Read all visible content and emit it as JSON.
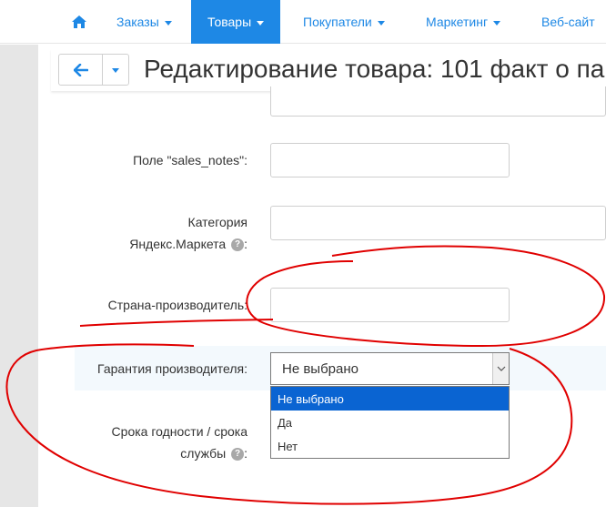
{
  "nav": {
    "items": [
      {
        "label": "Заказы",
        "active": false
      },
      {
        "label": "Товары",
        "active": true
      },
      {
        "label": "Покупатели",
        "active": false
      },
      {
        "label": "Маркетинг",
        "active": false
      },
      {
        "label": "Веб-сайт",
        "active": false
      }
    ]
  },
  "header": {
    "title": "Редактирование товара: 101 факт о па"
  },
  "form": {
    "sales_notes_label": "Поле \"sales_notes\":",
    "category_label_line1": "Категория",
    "category_label_line2": "Яндекс.Маркета",
    "country_label": "Страна-производитель:",
    "warranty_label": "Гарантия производителя:",
    "warranty_value": "Не выбрано",
    "warranty_options": [
      "Не выбрано",
      "Да",
      "Нет"
    ],
    "shelf_label_line1": "Срока годности / срока",
    "shelf_label_line2": "службы",
    "colon": ":",
    "help_glyph": "?"
  },
  "colors": {
    "accent": "#1e88e5",
    "selected_option": "#0a64d2",
    "annotation": "#e00000"
  }
}
